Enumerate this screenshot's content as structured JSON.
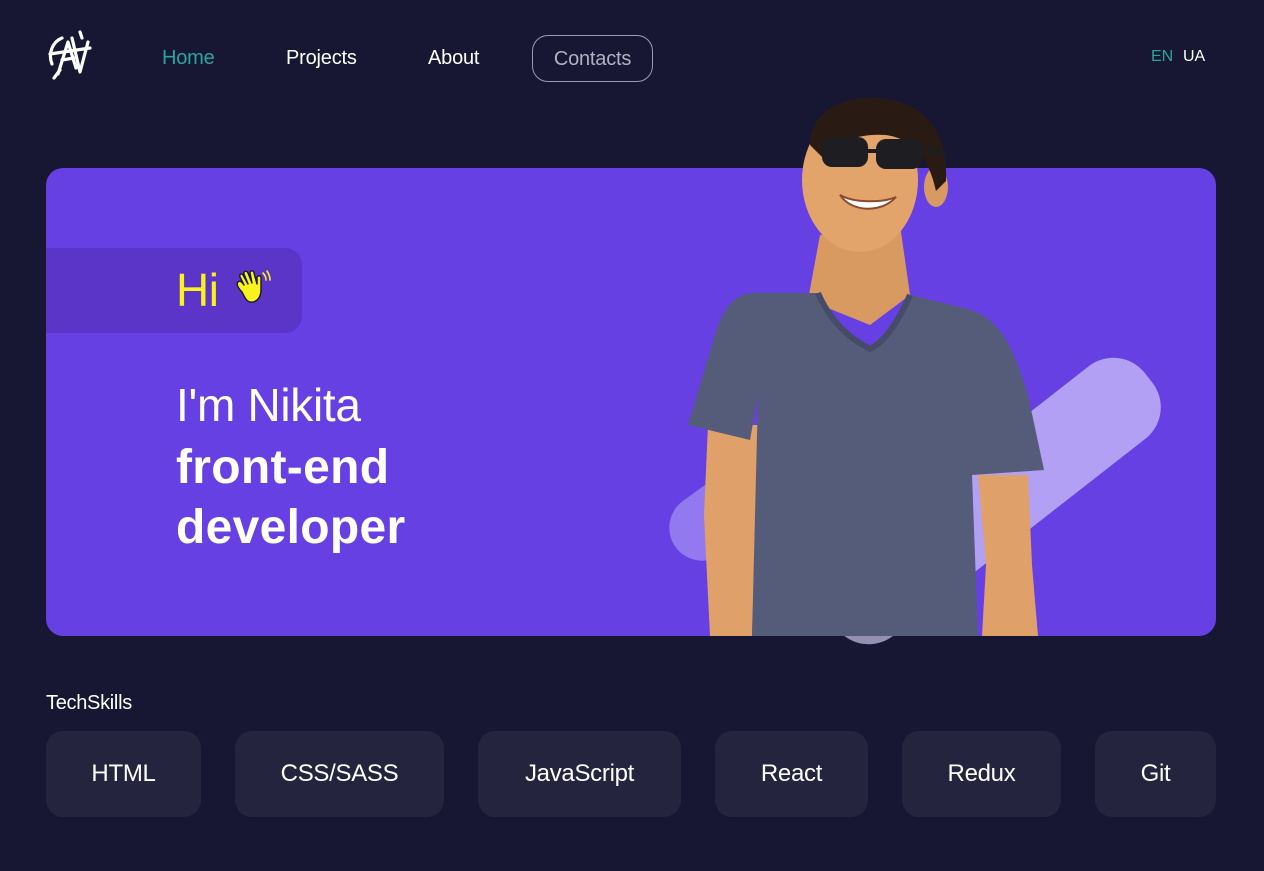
{
  "header": {
    "logo_icon": "monogram-logo-icon",
    "nav": [
      {
        "label": "Home",
        "active": true
      },
      {
        "label": "Projects",
        "active": false
      },
      {
        "label": "About",
        "active": false
      },
      {
        "label": "Contacts",
        "active": false
      }
    ],
    "languages": [
      {
        "label": "EN",
        "active": true
      },
      {
        "label": "UA",
        "active": false
      }
    ]
  },
  "hero": {
    "greeting": "Hi",
    "greeting_icon": "waving-hand-icon",
    "intro": "I'm Nikita",
    "role_line1": "front-end",
    "role_line2": "developer",
    "portrait_icon": "developer-portrait"
  },
  "skills": {
    "title": "TechSkills",
    "items": [
      "HTML",
      "CSS/SASS",
      "JavaScript",
      "React",
      "Redux",
      "Git"
    ]
  },
  "colors": {
    "background": "#171733",
    "accent": "#2aa59c",
    "hero": "#6740e3",
    "greeting": "#f8f21f",
    "skill_card": "#24243f"
  }
}
